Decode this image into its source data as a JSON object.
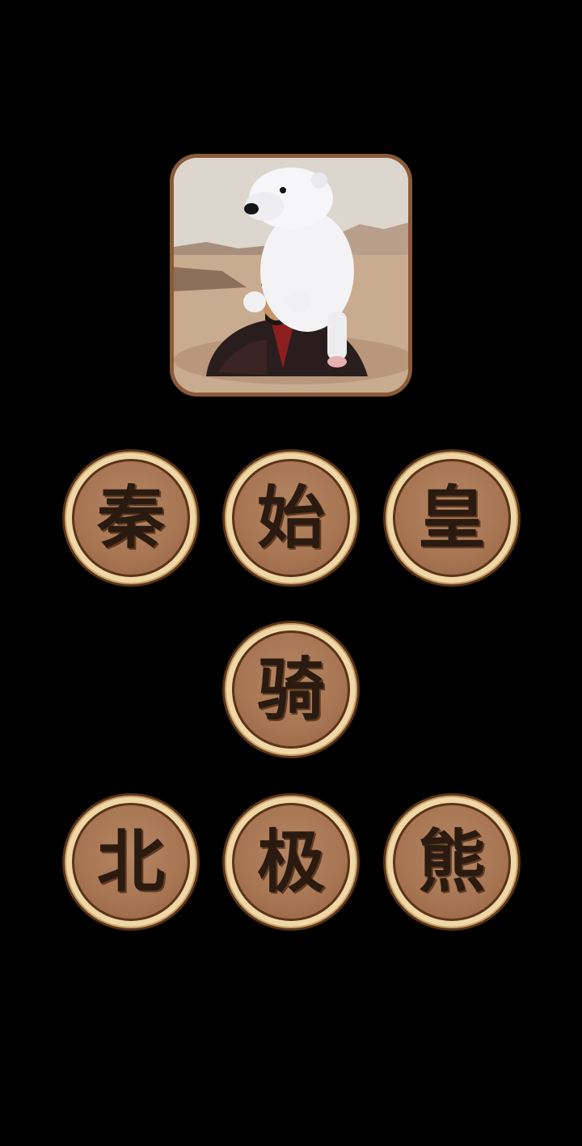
{
  "puzzle": {
    "image_icon": "polar-bear-on-emperor-picture",
    "frame_color": "#8a5a3a"
  },
  "answer_tiles": [
    {
      "char": "秦"
    },
    {
      "char": "始"
    },
    {
      "char": "皇"
    },
    {
      "char": "骑"
    },
    {
      "char": "北"
    },
    {
      "char": "极"
    },
    {
      "char": "熊"
    }
  ],
  "colors": {
    "background": "#000000",
    "tile_face": "#a77552",
    "tile_rim": "#efd7a8",
    "tile_text": "#2a1a10"
  }
}
